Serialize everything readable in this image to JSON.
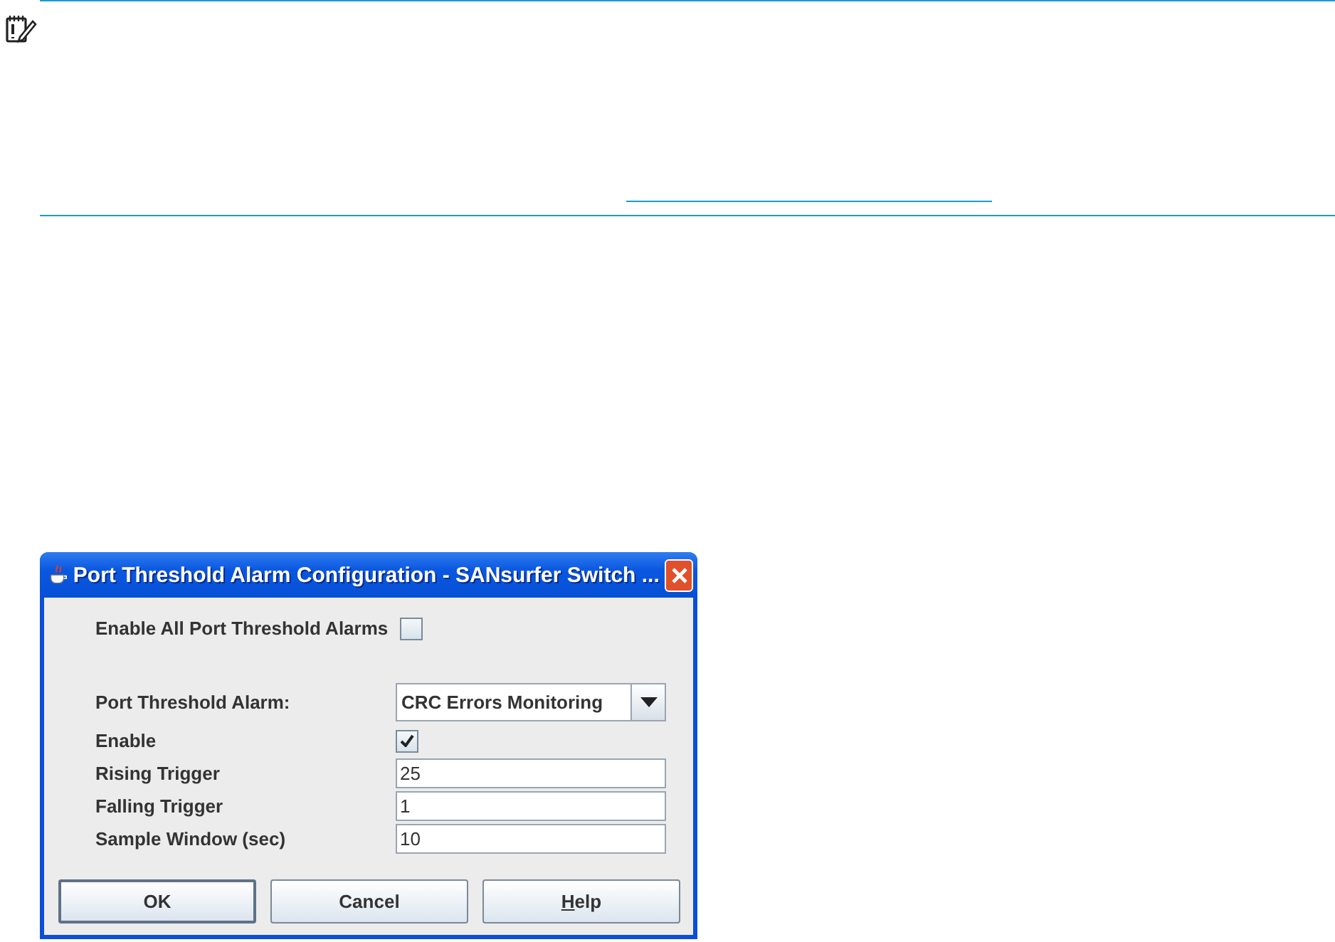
{
  "note": {
    "kind": "important"
  },
  "dialog": {
    "title": "Port Threshold Alarm Configuration - SANsurfer Switch ...",
    "enable_all": {
      "label": "Enable All Port Threshold Alarms",
      "checked": false
    },
    "fields": [
      {
        "kind": "dropdown",
        "label": "Port Threshold Alarm:",
        "value": "CRC Errors Monitoring"
      },
      {
        "kind": "checkbox",
        "label": "Enable",
        "checked": true
      },
      {
        "kind": "text",
        "label": "Rising Trigger",
        "value": "25"
      },
      {
        "kind": "text",
        "label": "Falling Trigger",
        "value": "1"
      },
      {
        "kind": "text",
        "label": "Sample Window (sec)",
        "value": "10"
      }
    ],
    "buttons": [
      {
        "label": "OK",
        "default": true
      },
      {
        "label": "Cancel",
        "default": false
      },
      {
        "label": "Help",
        "default": false,
        "mnemonic": true
      }
    ]
  }
}
